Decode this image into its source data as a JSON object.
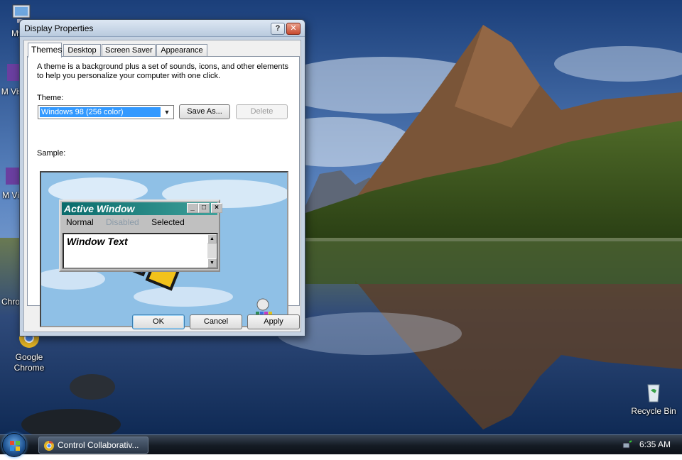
{
  "desktop": {
    "icons": [
      {
        "label": "My C",
        "glyph": "my-computer-icon"
      },
      {
        "label": "M Visu",
        "glyph": "visual-studio-icon"
      },
      {
        "label": "M Vis",
        "glyph": "visual-studio-icon"
      },
      {
        "label": "Chro",
        "glyph": "chrome-icon"
      },
      {
        "label": "Google Chrome",
        "glyph": "chrome-icon"
      },
      {
        "label": "Recycle Bin",
        "glyph": "recycle-bin-icon"
      }
    ]
  },
  "window": {
    "title": "Display Properties",
    "help_label": "?",
    "close_label": "✕",
    "tabs": [
      "Themes",
      "Desktop",
      "Screen Saver",
      "Appearance"
    ],
    "active_tab": "Themes",
    "description": "A theme is a background plus a set of sounds, icons, and other elements to help you personalize your computer with one click.",
    "theme_label": "Theme:",
    "theme_value": "Windows 98 (256 color)",
    "save_as_label": "Save As...",
    "delete_label": "Delete",
    "sample_label": "Sample:",
    "sample": {
      "title": "Active Window",
      "menu": [
        "Normal",
        "Disabled",
        "Selected"
      ],
      "text": "Window Text"
    },
    "ok_label": "OK",
    "cancel_label": "Cancel",
    "apply_label": "Apply"
  },
  "taskbar": {
    "task_label": "Control Collaborativ...",
    "clock": "6:35 AM"
  },
  "colors": {
    "selection": "#3399ff",
    "w98_title_start": "#0a6b6b",
    "w98_title_end": "#3ea09a",
    "taskbar": "#141b24"
  }
}
